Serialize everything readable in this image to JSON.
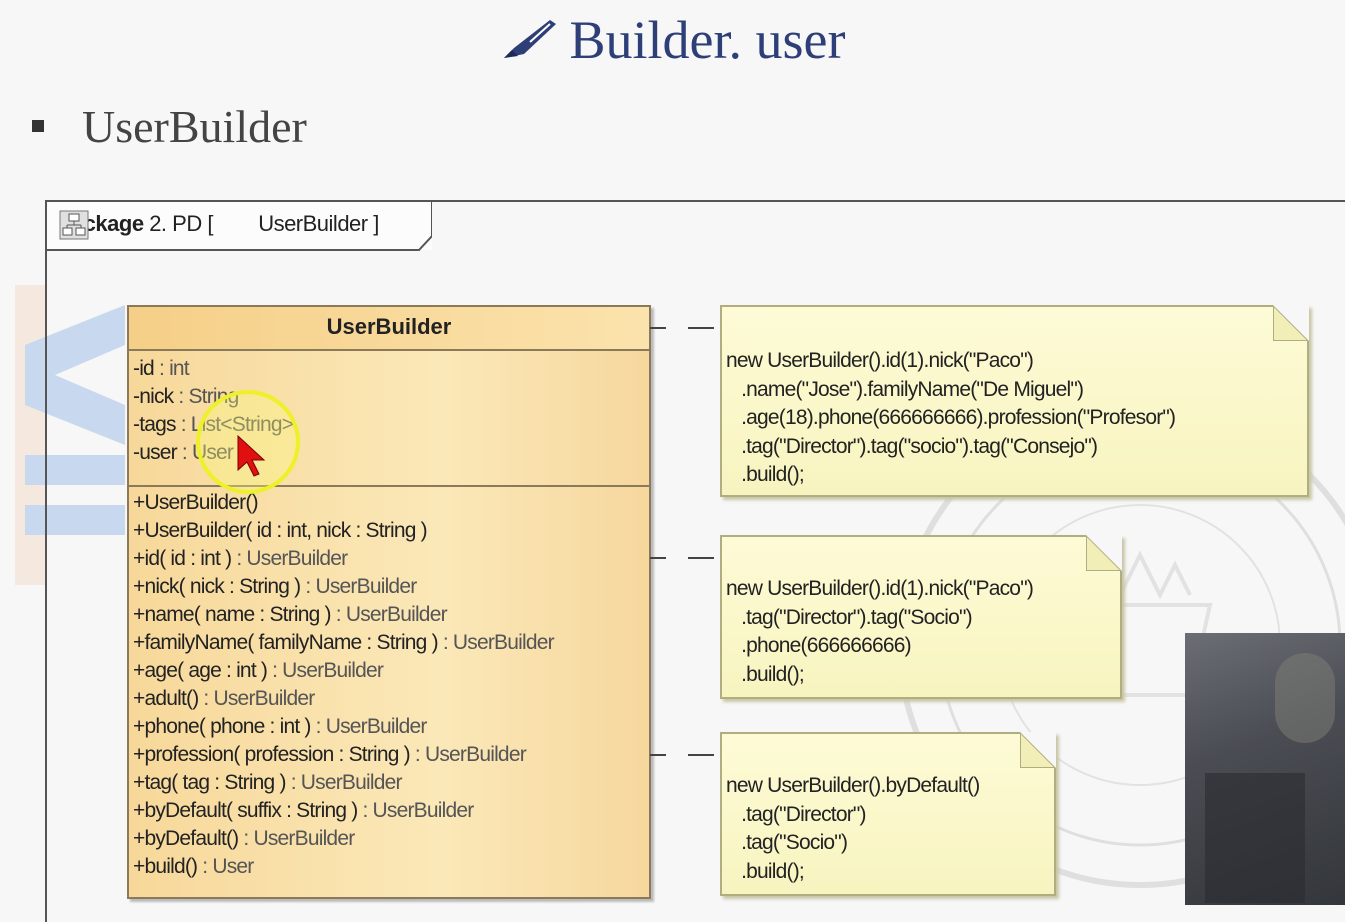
{
  "slide": {
    "title": "Builder. user",
    "title_icon": "pen-icon",
    "bullet": "UserBuilder"
  },
  "diagram": {
    "frame_keyword": "package",
    "frame_label_prefix": "2. PD [",
    "frame_icon": "class-diagram-icon",
    "frame_label_name": "UserBuilder ]",
    "class": {
      "name": "UserBuilder",
      "attributes": [
        {
          "name": "-id",
          "sep": " : ",
          "type": "int"
        },
        {
          "name": "-nick",
          "sep": " : ",
          "type": "String"
        },
        {
          "name": "-tags",
          "sep": " : ",
          "type": "List<String>"
        },
        {
          "name": "-user",
          "sep": " : ",
          "type": "User"
        }
      ],
      "operations": [
        {
          "sig": "+UserBuilder()",
          "ret": ""
        },
        {
          "sig": "+UserBuilder( id : int, nick : String )",
          "ret": ""
        },
        {
          "sig": "+id( id : int )",
          "ret": " : UserBuilder"
        },
        {
          "sig": "+nick( nick : String )",
          "ret": " : UserBuilder"
        },
        {
          "sig": "+name( name : String )",
          "ret": " : UserBuilder"
        },
        {
          "sig": "+familyName( familyName : String )",
          "ret": " : UserBuilder"
        },
        {
          "sig": "+age( age : int )",
          "ret": " : UserBuilder"
        },
        {
          "sig": "+adult()",
          "ret": " : UserBuilder"
        },
        {
          "sig": "+phone( phone : int )",
          "ret": " : UserBuilder"
        },
        {
          "sig": "+profession( profession : String )",
          "ret": " : UserBuilder"
        },
        {
          "sig": "+tag( tag : String )",
          "ret": " : UserBuilder"
        },
        {
          "sig": "+byDefault( suffix : String )",
          "ret": " : UserBuilder"
        },
        {
          "sig": "+byDefault()",
          "ret": " : UserBuilder"
        },
        {
          "sig": "+build()",
          "ret": " : User"
        }
      ]
    },
    "notes": [
      {
        "lines": [
          "new UserBuilder().id(1).nick(\"Paco\")",
          "   .name(\"Jose\").familyName(\"De Miguel\")",
          "   .age(18).phone(666666666).profession(\"Profesor\")",
          "   .tag(\"Director\").tag(\"socio\").tag(\"Consejo\")",
          "   .build();"
        ]
      },
      {
        "lines": [
          "new UserBuilder().id(1).nick(\"Paco\")",
          "   .tag(\"Director\").tag(\"Socio\")",
          "   .phone(666666666)",
          "   .build();"
        ]
      },
      {
        "lines": [
          "new UserBuilder().byDefault()",
          "   .tag(\"Director\")",
          "   .tag(\"Socio\")",
          "   .build();"
        ]
      }
    ]
  }
}
